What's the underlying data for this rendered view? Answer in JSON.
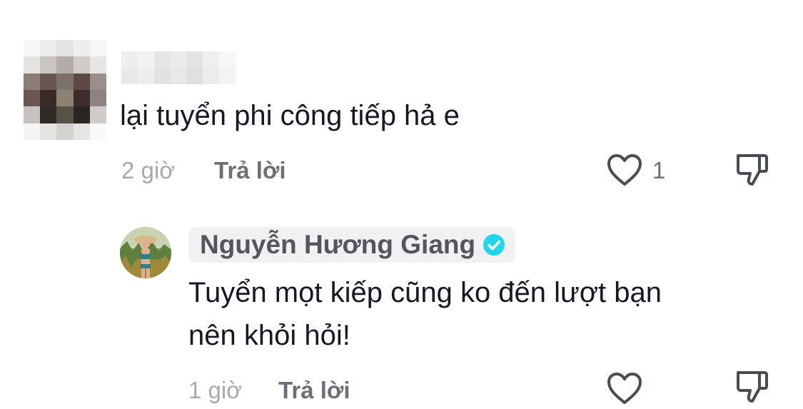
{
  "comments": [
    {
      "text": "lại tuyển phi công tiếp hả e",
      "time": "2 giờ",
      "reply_label": "Trả lời",
      "like_count": "1"
    },
    {
      "author": "Nguyễn Hương Giang",
      "verified": true,
      "text_line1": "Tuyển mọt kiếp cũng ko đến lượt bạn",
      "text_line2": "nên khỏi hỏi!",
      "time": "1 giờ",
      "reply_label": "Trả lời"
    }
  ],
  "icons": {
    "like": "heart-outline-icon",
    "dislike": "thumbs-down-outline-icon",
    "verified": "verified-check-icon"
  },
  "colors": {
    "text": "#161823",
    "meta": "#a8a8ad",
    "reply": "#6e6f76",
    "verified": "#20d5ec"
  }
}
